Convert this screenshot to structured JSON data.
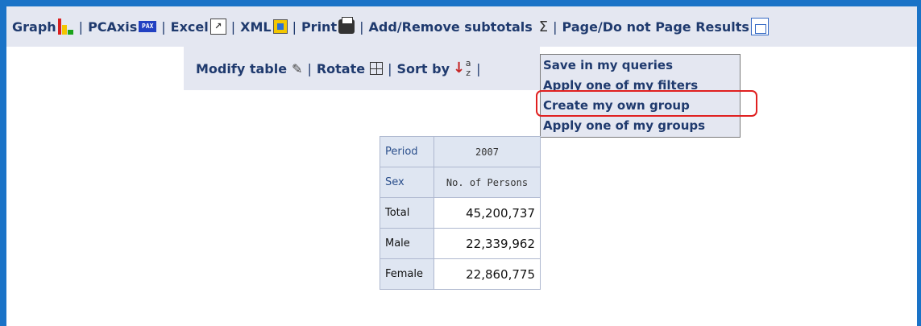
{
  "toolbar1": {
    "graph_label": "Graph",
    "pcaxis_label": "PCAxis",
    "pcaxis_badge": "PAX",
    "excel_label": "Excel",
    "xml_label": "XML",
    "print_label": "Print",
    "subtotals_label": "Add/Remove subtotals",
    "subtotals_icon": "Σ",
    "page_label": "Page/Do not Page Results",
    "separator": "|"
  },
  "toolbar2": {
    "modify_label": "Modify table",
    "rotate_label": "Rotate",
    "sort_label": "Sort by",
    "sort_az": "a z",
    "separator": "|"
  },
  "dropdown": {
    "items": [
      "Save in my queries",
      "Apply one of my filters",
      "Create my own group",
      "Apply one of my groups"
    ],
    "highlighted_index": 2
  },
  "table": {
    "header_rows": [
      {
        "label": "Period",
        "value": "2007"
      },
      {
        "label": "Sex",
        "value": "No. of Persons"
      }
    ],
    "rows": [
      {
        "label": "Total",
        "value": "45,200,737"
      },
      {
        "label": "Male",
        "value": "22,339,962"
      },
      {
        "label": "Female",
        "value": "22,860,775"
      }
    ]
  },
  "colors": {
    "frame": "#1a73c7",
    "toolbar_bg": "#e4e7f1",
    "link_text": "#1f3a6e",
    "highlight": "#e02020"
  }
}
